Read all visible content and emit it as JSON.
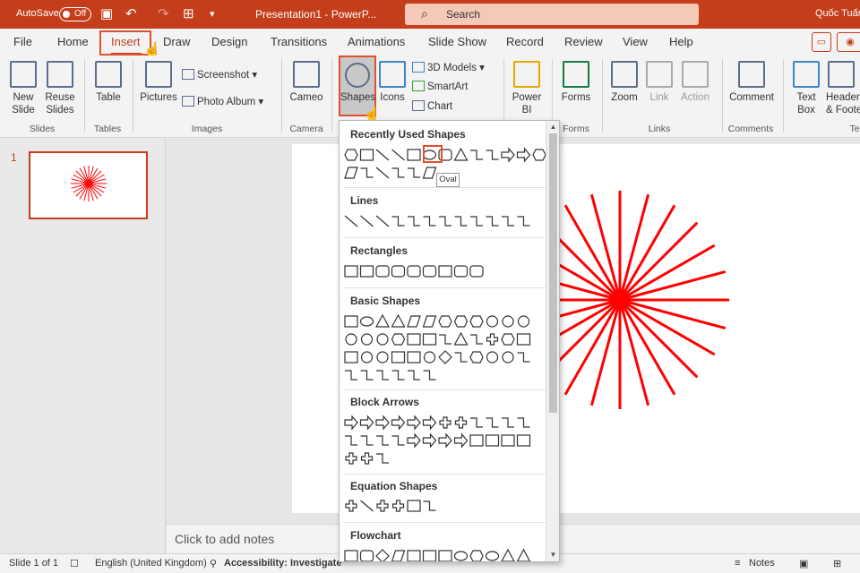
{
  "window": {
    "autosave_label": "AutoSave",
    "autosave_state": "Off",
    "document_title": "Presentation1  -  PowerP...",
    "search_placeholder": "Search",
    "user_name": "Quốc Tuấn"
  },
  "tabs": [
    "File",
    "Home",
    "Insert",
    "Draw",
    "Design",
    "Transitions",
    "Animations",
    "Slide Show",
    "Record",
    "Review",
    "View",
    "Help"
  ],
  "active_tab": "Insert",
  "ribbon": {
    "new_slide": "New\nSlide",
    "reuse_slides": "Reuse\nSlides",
    "table": "Table",
    "pictures": "Pictures",
    "screenshot": "Screenshot",
    "photo_album": "Photo Album",
    "cameo": "Cameo",
    "shapes": "Shapes",
    "icons": "Icons",
    "models3d": "3D Models",
    "smartart": "SmartArt",
    "chart": "Chart",
    "power_bi": "Power\nBI",
    "forms": "Forms",
    "zoom": "Zoom",
    "link": "Link",
    "action": "Action",
    "comment": "Comment",
    "text_box": "Text\nBox",
    "header_footer": "Header\n& Foote",
    "groups": {
      "slides": "Slides",
      "tables": "Tables",
      "images": "Images",
      "camera": "Camera",
      "forms": "Forms",
      "links": "Links",
      "comments": "Comments",
      "text": "Te"
    }
  },
  "thumbnail": {
    "slide_number": "1"
  },
  "notes_placeholder": "Click to add notes",
  "status": {
    "slide_position": "Slide 1 of 1",
    "language": "English (United Kingdom)",
    "accessibility": "Accessibility: Investigate",
    "notes_button": "Notes"
  },
  "shapes_menu": {
    "categories": [
      "Recently Used Shapes",
      "Lines",
      "Rectangles",
      "Basic Shapes",
      "Block Arrows",
      "Equation Shapes",
      "Flowchart"
    ],
    "tooltip": "Oval"
  },
  "colors": {
    "accent": "#c43e1c",
    "highlight": "#e0502e",
    "starburst": "#ff0000"
  }
}
